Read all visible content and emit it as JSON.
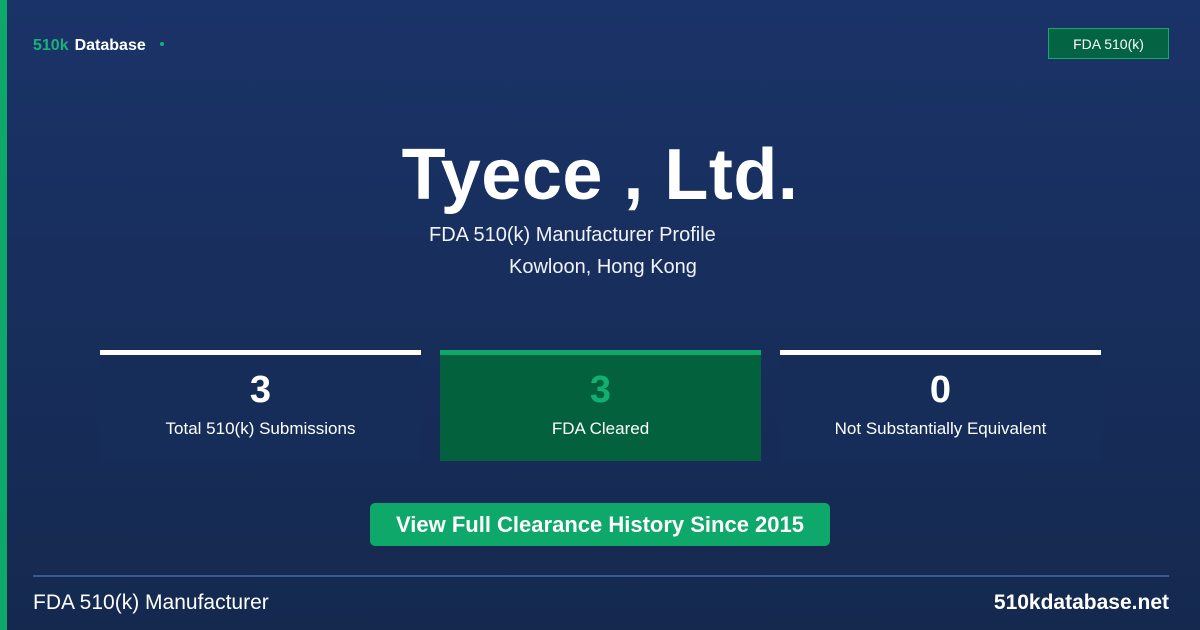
{
  "brand": {
    "part1": "510k",
    "part2": "Database"
  },
  "tag": "FDA 510(k)",
  "company": {
    "name": "Tyece , Ltd.",
    "subtitle": "FDA 510(k) Manufacturer Profile",
    "location": "Kowloon, Hong Kong"
  },
  "stats": [
    {
      "value": "3",
      "label": "Total 510(k) Submissions"
    },
    {
      "value": "3",
      "label": "FDA Cleared"
    },
    {
      "value": "0",
      "label": "Not Substantially Equivalent"
    }
  ],
  "cta": "View Full Clearance History Since 2015",
  "footer": {
    "left": "FDA 510(k) Manufacturer",
    "right": "510kdatabase.net"
  },
  "colors": {
    "accent": "#0ea86a",
    "background": "#1a3368",
    "card": "#162d5a",
    "card_highlight": "#03613e"
  }
}
